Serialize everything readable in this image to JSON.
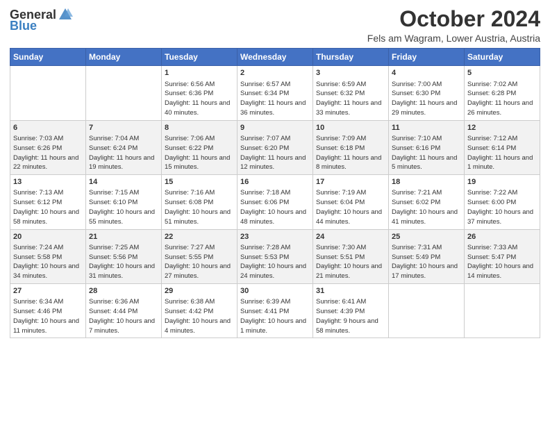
{
  "header": {
    "logo": {
      "general": "General",
      "blue": "Blue"
    },
    "title": "October 2024",
    "location": "Fels am Wagram, Lower Austria, Austria"
  },
  "days_of_week": [
    "Sunday",
    "Monday",
    "Tuesday",
    "Wednesday",
    "Thursday",
    "Friday",
    "Saturday"
  ],
  "weeks": [
    [
      {
        "day": "",
        "sunrise": "",
        "sunset": "",
        "daylight": ""
      },
      {
        "day": "",
        "sunrise": "",
        "sunset": "",
        "daylight": ""
      },
      {
        "day": "1",
        "sunrise": "Sunrise: 6:56 AM",
        "sunset": "Sunset: 6:36 PM",
        "daylight": "Daylight: 11 hours and 40 minutes."
      },
      {
        "day": "2",
        "sunrise": "Sunrise: 6:57 AM",
        "sunset": "Sunset: 6:34 PM",
        "daylight": "Daylight: 11 hours and 36 minutes."
      },
      {
        "day": "3",
        "sunrise": "Sunrise: 6:59 AM",
        "sunset": "Sunset: 6:32 PM",
        "daylight": "Daylight: 11 hours and 33 minutes."
      },
      {
        "day": "4",
        "sunrise": "Sunrise: 7:00 AM",
        "sunset": "Sunset: 6:30 PM",
        "daylight": "Daylight: 11 hours and 29 minutes."
      },
      {
        "day": "5",
        "sunrise": "Sunrise: 7:02 AM",
        "sunset": "Sunset: 6:28 PM",
        "daylight": "Daylight: 11 hours and 26 minutes."
      }
    ],
    [
      {
        "day": "6",
        "sunrise": "Sunrise: 7:03 AM",
        "sunset": "Sunset: 6:26 PM",
        "daylight": "Daylight: 11 hours and 22 minutes."
      },
      {
        "day": "7",
        "sunrise": "Sunrise: 7:04 AM",
        "sunset": "Sunset: 6:24 PM",
        "daylight": "Daylight: 11 hours and 19 minutes."
      },
      {
        "day": "8",
        "sunrise": "Sunrise: 7:06 AM",
        "sunset": "Sunset: 6:22 PM",
        "daylight": "Daylight: 11 hours and 15 minutes."
      },
      {
        "day": "9",
        "sunrise": "Sunrise: 7:07 AM",
        "sunset": "Sunset: 6:20 PM",
        "daylight": "Daylight: 11 hours and 12 minutes."
      },
      {
        "day": "10",
        "sunrise": "Sunrise: 7:09 AM",
        "sunset": "Sunset: 6:18 PM",
        "daylight": "Daylight: 11 hours and 8 minutes."
      },
      {
        "day": "11",
        "sunrise": "Sunrise: 7:10 AM",
        "sunset": "Sunset: 6:16 PM",
        "daylight": "Daylight: 11 hours and 5 minutes."
      },
      {
        "day": "12",
        "sunrise": "Sunrise: 7:12 AM",
        "sunset": "Sunset: 6:14 PM",
        "daylight": "Daylight: 11 hours and 1 minute."
      }
    ],
    [
      {
        "day": "13",
        "sunrise": "Sunrise: 7:13 AM",
        "sunset": "Sunset: 6:12 PM",
        "daylight": "Daylight: 10 hours and 58 minutes."
      },
      {
        "day": "14",
        "sunrise": "Sunrise: 7:15 AM",
        "sunset": "Sunset: 6:10 PM",
        "daylight": "Daylight: 10 hours and 55 minutes."
      },
      {
        "day": "15",
        "sunrise": "Sunrise: 7:16 AM",
        "sunset": "Sunset: 6:08 PM",
        "daylight": "Daylight: 10 hours and 51 minutes."
      },
      {
        "day": "16",
        "sunrise": "Sunrise: 7:18 AM",
        "sunset": "Sunset: 6:06 PM",
        "daylight": "Daylight: 10 hours and 48 minutes."
      },
      {
        "day": "17",
        "sunrise": "Sunrise: 7:19 AM",
        "sunset": "Sunset: 6:04 PM",
        "daylight": "Daylight: 10 hours and 44 minutes."
      },
      {
        "day": "18",
        "sunrise": "Sunrise: 7:21 AM",
        "sunset": "Sunset: 6:02 PM",
        "daylight": "Daylight: 10 hours and 41 minutes."
      },
      {
        "day": "19",
        "sunrise": "Sunrise: 7:22 AM",
        "sunset": "Sunset: 6:00 PM",
        "daylight": "Daylight: 10 hours and 37 minutes."
      }
    ],
    [
      {
        "day": "20",
        "sunrise": "Sunrise: 7:24 AM",
        "sunset": "Sunset: 5:58 PM",
        "daylight": "Daylight: 10 hours and 34 minutes."
      },
      {
        "day": "21",
        "sunrise": "Sunrise: 7:25 AM",
        "sunset": "Sunset: 5:56 PM",
        "daylight": "Daylight: 10 hours and 31 minutes."
      },
      {
        "day": "22",
        "sunrise": "Sunrise: 7:27 AM",
        "sunset": "Sunset: 5:55 PM",
        "daylight": "Daylight: 10 hours and 27 minutes."
      },
      {
        "day": "23",
        "sunrise": "Sunrise: 7:28 AM",
        "sunset": "Sunset: 5:53 PM",
        "daylight": "Daylight: 10 hours and 24 minutes."
      },
      {
        "day": "24",
        "sunrise": "Sunrise: 7:30 AM",
        "sunset": "Sunset: 5:51 PM",
        "daylight": "Daylight: 10 hours and 21 minutes."
      },
      {
        "day": "25",
        "sunrise": "Sunrise: 7:31 AM",
        "sunset": "Sunset: 5:49 PM",
        "daylight": "Daylight: 10 hours and 17 minutes."
      },
      {
        "day": "26",
        "sunrise": "Sunrise: 7:33 AM",
        "sunset": "Sunset: 5:47 PM",
        "daylight": "Daylight: 10 hours and 14 minutes."
      }
    ],
    [
      {
        "day": "27",
        "sunrise": "Sunrise: 6:34 AM",
        "sunset": "Sunset: 4:46 PM",
        "daylight": "Daylight: 10 hours and 11 minutes."
      },
      {
        "day": "28",
        "sunrise": "Sunrise: 6:36 AM",
        "sunset": "Sunset: 4:44 PM",
        "daylight": "Daylight: 10 hours and 7 minutes."
      },
      {
        "day": "29",
        "sunrise": "Sunrise: 6:38 AM",
        "sunset": "Sunset: 4:42 PM",
        "daylight": "Daylight: 10 hours and 4 minutes."
      },
      {
        "day": "30",
        "sunrise": "Sunrise: 6:39 AM",
        "sunset": "Sunset: 4:41 PM",
        "daylight": "Daylight: 10 hours and 1 minute."
      },
      {
        "day": "31",
        "sunrise": "Sunrise: 6:41 AM",
        "sunset": "Sunset: 4:39 PM",
        "daylight": "Daylight: 9 hours and 58 minutes."
      },
      {
        "day": "",
        "sunrise": "",
        "sunset": "",
        "daylight": ""
      },
      {
        "day": "",
        "sunrise": "",
        "sunset": "",
        "daylight": ""
      }
    ]
  ]
}
